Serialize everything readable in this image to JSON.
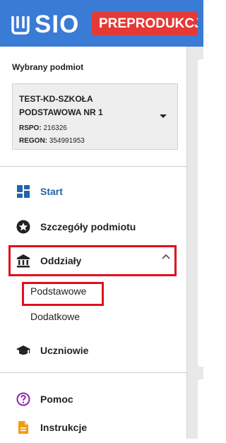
{
  "header": {
    "logo_text": "SIO",
    "environment_badge": "PREPRODUKCJA",
    "background_color": "#3a7bd5",
    "badge_color": "#e53935"
  },
  "entity": {
    "section_label": "Wybrany podmiot",
    "name_line1": "TEST-KD-SZKOŁA",
    "name_line2": "PODSTAWOWA NR 1",
    "rspo_label": "RSPO:",
    "rspo_value": "216326",
    "regon_label": "REGON:",
    "regon_value": "354991953"
  },
  "nav": {
    "start": {
      "label": "Start",
      "icon": "dashboard-icon",
      "active": true
    },
    "details": {
      "label": "Szczegóły podmiotu",
      "icon": "star-badge-icon"
    },
    "divisions": {
      "label": "Oddziały",
      "icon": "institution-icon",
      "expanded": true,
      "sub_items": [
        {
          "label": "Podstawowe"
        },
        {
          "label": "Dodatkowe"
        }
      ]
    },
    "students": {
      "label": "Uczniowie",
      "icon": "graduation-cap-icon"
    },
    "help": {
      "label": "Pomoc",
      "icon": "help-circle-icon"
    },
    "instructions": {
      "label": "Instrukcje",
      "icon": "document-icon"
    }
  },
  "colors": {
    "accent": "#2563a8",
    "highlight": "#e0101e",
    "help_icon": "#8e24aa",
    "instructions_icon": "#f39c12"
  }
}
